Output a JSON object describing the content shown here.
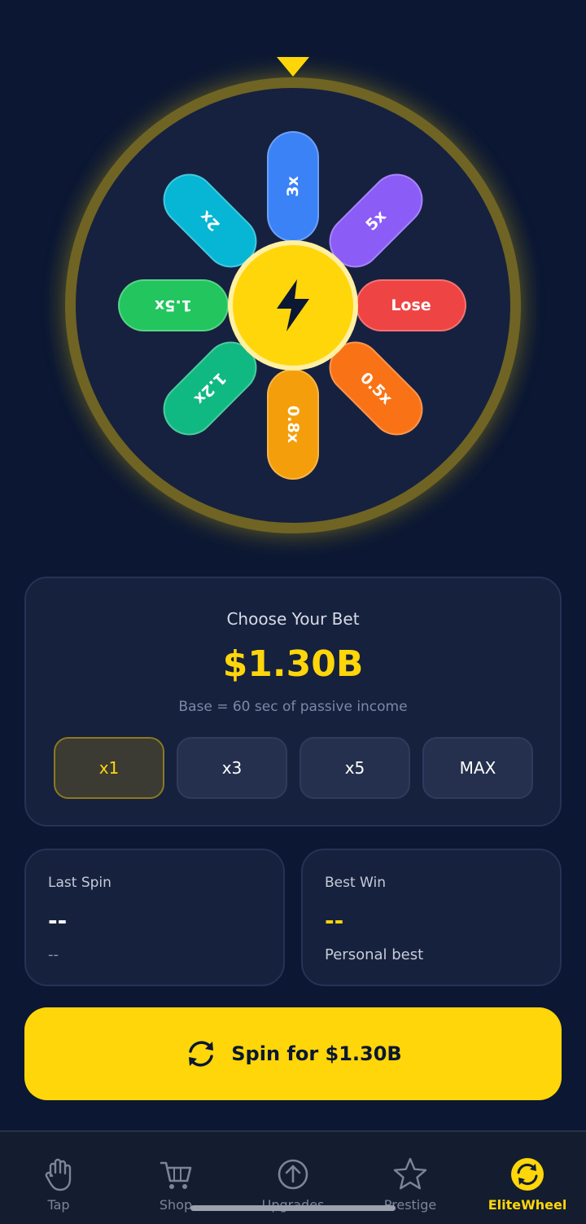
{
  "wheel": {
    "segments": [
      {
        "label": "3x",
        "color": "#3b82f6"
      },
      {
        "label": "5x",
        "color": "#8b5cf6"
      },
      {
        "label": "Lose",
        "color": "#ef4444"
      },
      {
        "label": "0.5x",
        "color": "#f97316"
      },
      {
        "label": "0.8x",
        "color": "#f59e0b"
      },
      {
        "label": "1.2x",
        "color": "#10b981"
      },
      {
        "label": "1.5x",
        "color": "#22c55e"
      },
      {
        "label": "2x",
        "color": "#06b6d4"
      }
    ],
    "hub_icon": "lightning-bolt-icon"
  },
  "bet": {
    "title": "Choose Your Bet",
    "amount": "$1.30B",
    "subtitle": "Base = 60 sec of passive income",
    "multipliers": [
      "x1",
      "x3",
      "x5",
      "MAX"
    ],
    "selected": "x1"
  },
  "stats": {
    "last_spin": {
      "label": "Last Spin",
      "value": "--",
      "note": "--"
    },
    "best_win": {
      "label": "Best Win",
      "value": "--",
      "note": "Personal best"
    }
  },
  "spin_button": {
    "label": "Spin for $1.30B",
    "icon": "refresh-icon"
  },
  "nav": {
    "items": [
      {
        "label": "Tap",
        "icon": "hand-icon"
      },
      {
        "label": "Shop",
        "icon": "cart-icon"
      },
      {
        "label": "Upgrades",
        "icon": "arrow-up-circle-icon"
      },
      {
        "label": "Prestige",
        "icon": "star-icon"
      },
      {
        "label": "EliteWheel",
        "icon": "wheel-icon"
      }
    ],
    "active": "EliteWheel"
  },
  "colors": {
    "accent": "#ffd60a",
    "background": "#0b1733",
    "card": "#16213d"
  }
}
